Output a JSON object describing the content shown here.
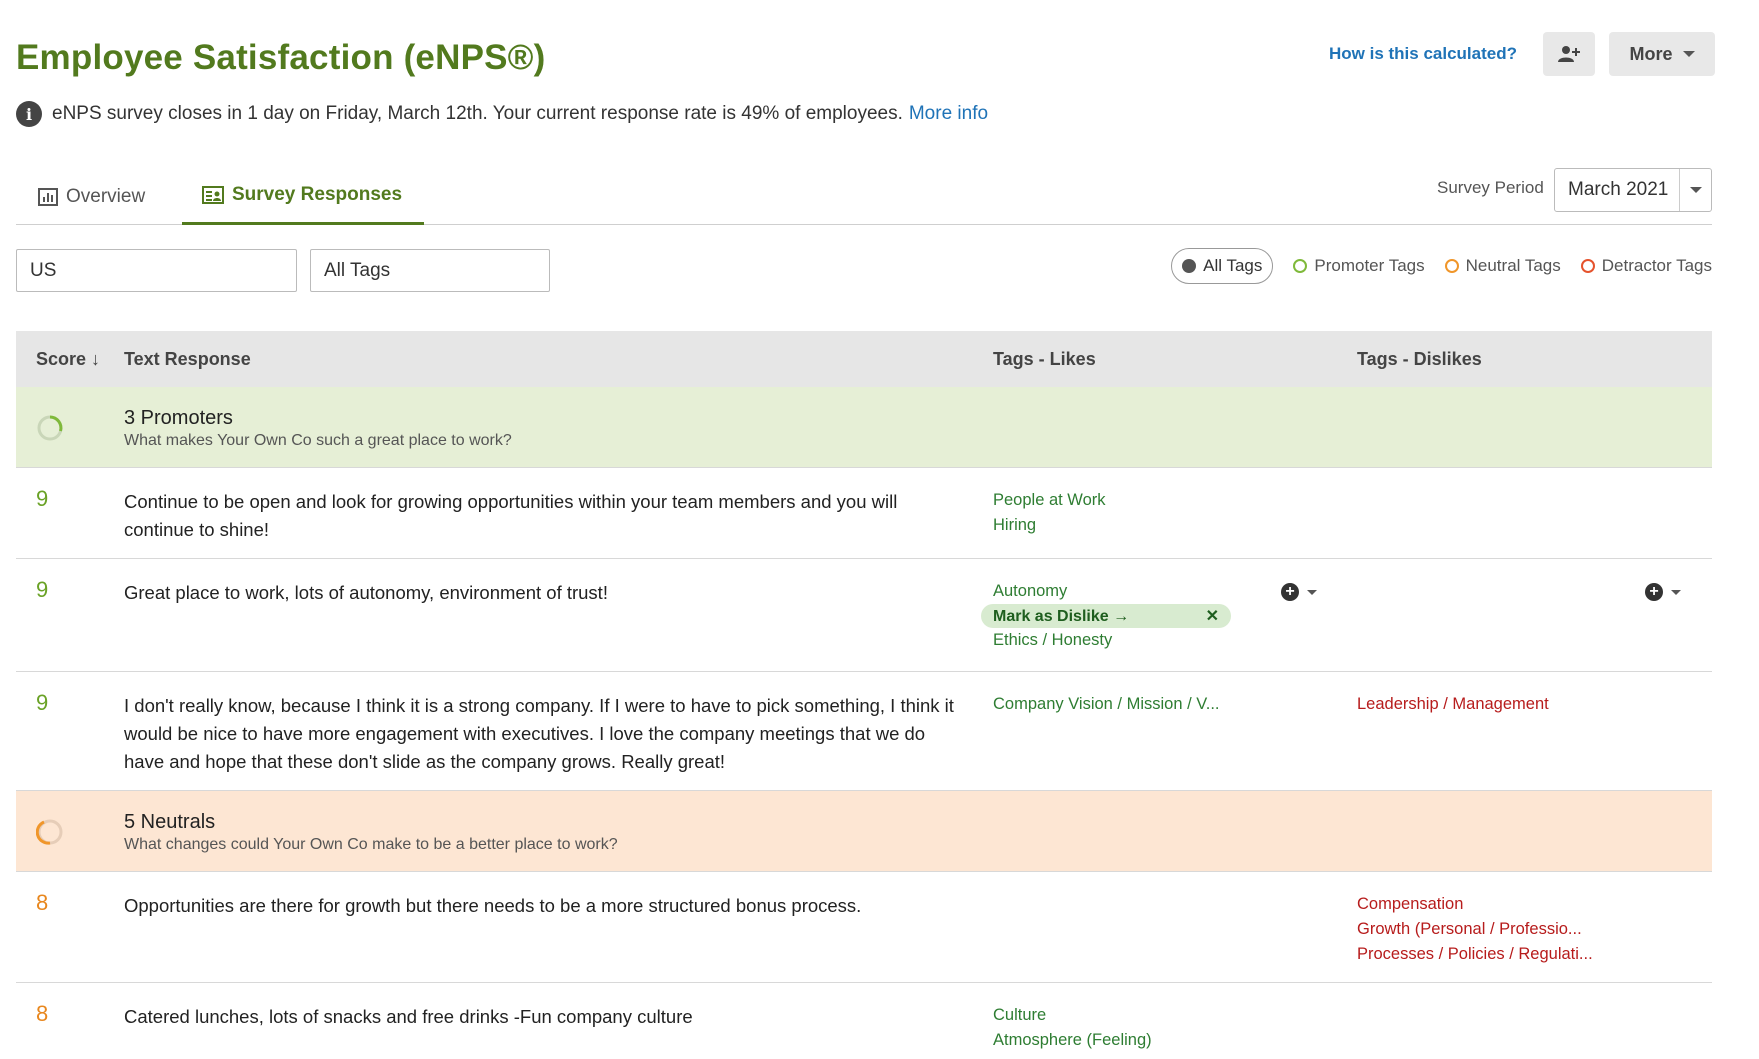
{
  "header": {
    "title": "Employee Satisfaction (eNPS®)",
    "how_link": "How is this calculated?",
    "more_label": "More"
  },
  "info": {
    "message": "eNPS survey closes in 1 day on Friday, March 12th. Your current response rate is 49% of employees.",
    "link": "More info"
  },
  "tabs": {
    "overview": "Overview",
    "survey_responses": "Survey Responses"
  },
  "survey_period": {
    "label": "Survey Period",
    "value": "March 2021"
  },
  "filters": {
    "location": "US",
    "tags": "All Tags"
  },
  "tag_filters": {
    "all": "All Tags",
    "promoter": "Promoter Tags",
    "neutral": "Neutral Tags",
    "detractor": "Detractor Tags"
  },
  "table": {
    "headers": {
      "score": "Score ↓",
      "text": "Text Response",
      "likes": "Tags - Likes",
      "dislikes": "Tags - Dislikes"
    },
    "promoters": {
      "title": "3 Promoters",
      "question": "What makes Your Own Co such a great place to work?",
      "rows": [
        {
          "score": "9",
          "text": "Continue to be open and look for growing opportunities within your team members and you will continue to shine!",
          "likes": [
            "People at Work",
            "Hiring"
          ],
          "dislikes": []
        },
        {
          "score": "9",
          "text": "Great place to work, lots of autonomy, environment of trust!",
          "likes": [
            "Autonomy",
            "Ethics / Honesty"
          ],
          "mark_as_dislike": "Mark as Dislike →",
          "dislikes": []
        },
        {
          "score": "9",
          "text": "I don't really know, because I think it is a strong company. If I were to have to pick something, I think it would be nice to have more engagement with executives. I love the company meetings that we do have and hope that these don't slide as the company grows. Really great!",
          "likes": [
            "Company Vision / Mission / V..."
          ],
          "dislikes": [
            "Leadership / Management"
          ]
        }
      ]
    },
    "neutrals": {
      "title": "5 Neutrals",
      "question": "What changes could Your Own Co make to be a better place to work?",
      "rows": [
        {
          "score": "8",
          "text": "Opportunities are there for growth but there needs to be a more structured bonus process.",
          "likes": [],
          "dislikes": [
            "Compensation",
            "Growth (Personal / Professio...",
            "Processes / Policies / Regulati..."
          ]
        },
        {
          "score": "8",
          "text": "Catered lunches, lots of snacks and free drinks -Fun company culture",
          "likes": [
            "Culture",
            "Atmosphere (Feeling)"
          ],
          "dislikes": []
        }
      ]
    }
  },
  "colors": {
    "brand_green": "#527a1e",
    "link_blue": "#1f73b7",
    "promoter_bg": "#e6efd6",
    "neutral_bg": "#fde6d3",
    "like_tag": "#2e7d32",
    "dislike_tag": "#b71c1c"
  }
}
